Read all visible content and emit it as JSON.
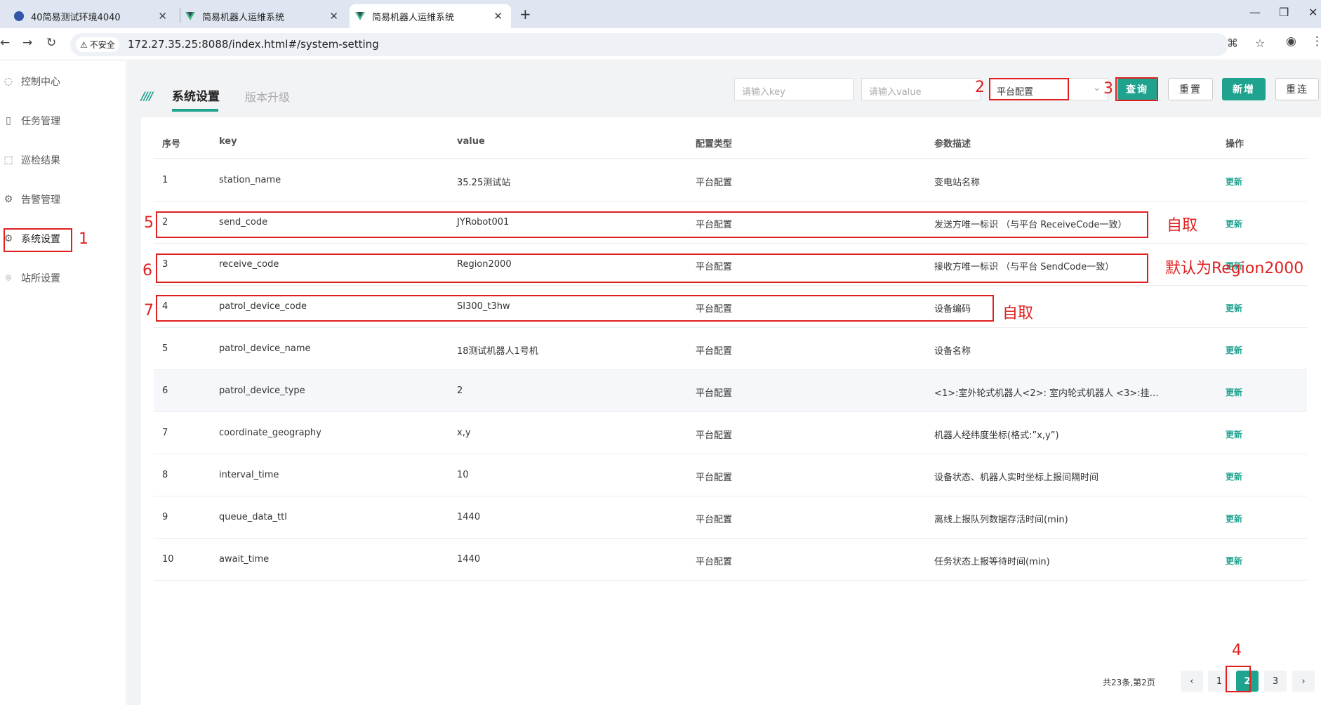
{
  "browser": {
    "tabs": [
      {
        "title": "40简易测试环境4040"
      },
      {
        "title": "简易机器人运维系统"
      },
      {
        "title": "简易机器人运维系统"
      }
    ],
    "security_label": "不安全",
    "url": "172.27.35.25:8088/index.html#/system-setting"
  },
  "sidebar": {
    "items": [
      {
        "label": "控制中心",
        "icon": "dashboard-icon"
      },
      {
        "label": "任务管理",
        "icon": "task-icon"
      },
      {
        "label": "巡检结果",
        "icon": "chip-icon"
      },
      {
        "label": "告警管理",
        "icon": "alarm-gear-icon"
      },
      {
        "label": "系统设置",
        "icon": "settings-icon"
      },
      {
        "label": "站所设置",
        "icon": "location-icon"
      }
    ]
  },
  "page_tabs": {
    "active": "系统设置",
    "other": "版本升级"
  },
  "filters": {
    "key_placeholder": "请输入key",
    "value_placeholder": "请输入value",
    "type_selected": "平台配置"
  },
  "buttons": {
    "query": "查询",
    "reset": "重置",
    "add": "新增",
    "reconnect": "重连"
  },
  "table": {
    "headers": [
      "序号",
      "key",
      "value",
      "配置类型",
      "参数描述",
      "操作"
    ],
    "rows": [
      {
        "no": "1",
        "key": "station_name",
        "value": "35.25测试站",
        "type": "平台配置",
        "desc": "变电站名称",
        "action": "更新"
      },
      {
        "no": "2",
        "key": "send_code",
        "value": "JYRobot001",
        "type": "平台配置",
        "desc": "发送方唯一标识 （与平台 ReceiveCode一致）",
        "action": "更新"
      },
      {
        "no": "3",
        "key": "receive_code",
        "value": "Region2000",
        "type": "平台配置",
        "desc": "接收方唯一标识 （与平台 SendCode一致）",
        "action": "更新"
      },
      {
        "no": "4",
        "key": "patrol_device_code",
        "value": "SI300_t3hw",
        "type": "平台配置",
        "desc": "设备编码",
        "action": "更新"
      },
      {
        "no": "5",
        "key": "patrol_device_name",
        "value": "18测试机器人1号机",
        "type": "平台配置",
        "desc": "设备名称",
        "action": "更新"
      },
      {
        "no": "6",
        "key": "patrol_device_type",
        "value": "2",
        "type": "平台配置",
        "desc": "<1>:室外轮式机器人<2>: 室内轮式机器人 <3>:挂…",
        "action": "更新"
      },
      {
        "no": "7",
        "key": "coordinate_geography",
        "value": "x,y",
        "type": "平台配置",
        "desc": "机器人经纬度坐标(格式:”x,y”)",
        "action": "更新"
      },
      {
        "no": "8",
        "key": "interval_time",
        "value": "10",
        "type": "平台配置",
        "desc": "设备状态、机器人实时坐标上报间隔时间",
        "action": "更新"
      },
      {
        "no": "9",
        "key": "queue_data_ttl",
        "value": "1440",
        "type": "平台配置",
        "desc": "离线上报队列数据存活时间(min)",
        "action": "更新"
      },
      {
        "no": "10",
        "key": "await_time",
        "value": "1440",
        "type": "平台配置",
        "desc": "任务状态上报等待时间(min)",
        "action": "更新"
      }
    ]
  },
  "pagination": {
    "summary": "共23条,第2页",
    "pages": [
      "1",
      "2",
      "3"
    ],
    "current": "2"
  },
  "annotations": {
    "n1": "1",
    "n2": "2",
    "n3": "3",
    "n4": "4",
    "n5": "5",
    "n6": "6",
    "n7": "7",
    "self_take": "自取",
    "default_region": "默认为Region2000"
  },
  "colors": {
    "accent": "#1fa38f",
    "annotation": "#e02020"
  }
}
